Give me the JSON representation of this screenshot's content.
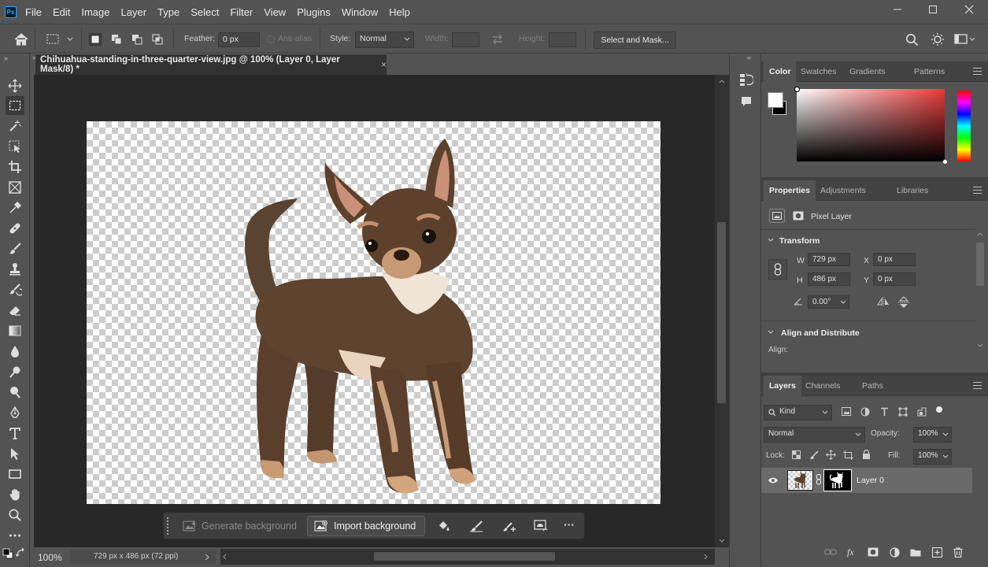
{
  "app": {
    "logo_text": "Ps",
    "menu": [
      "File",
      "Edit",
      "Image",
      "Layer",
      "Type",
      "Select",
      "Filter",
      "View",
      "Plugins",
      "Window",
      "Help"
    ]
  },
  "options_bar": {
    "feather_label": "Feather:",
    "feather_value": "0 px",
    "antialias_label": "Anti-alias",
    "style_label": "Style:",
    "style_value": "Normal",
    "width_label": "Width:",
    "height_label": "Height:",
    "select_and_mask": "Select and Mask..."
  },
  "document": {
    "tab_title": "Chihuahua-standing-in-three-quarter-view.jpg @ 100% (Layer 0, Layer Mask/8) *",
    "close_glyph": "×",
    "zoom": "100%",
    "doc_info": "729 px x 486 px (72 ppi)"
  },
  "contextual_bar": {
    "generate_background": "Generate background",
    "import_background": "Import background",
    "more": "···"
  },
  "color_panel": {
    "tabs": [
      "Color",
      "Swatches",
      "Gradients",
      "Patterns"
    ],
    "hue_color": "#e83a3a"
  },
  "properties_panel": {
    "tabs": [
      "Properties",
      "Adjustments",
      "Libraries"
    ],
    "layer_type": "Pixel Layer",
    "transform_title": "Transform",
    "w_label": "W",
    "w_value": "729 px",
    "h_label": "H",
    "h_value": "486 px",
    "x_label": "X",
    "x_value": "0 px",
    "y_label": "Y",
    "y_value": "0 px",
    "angle_value": "0.00°",
    "align_title": "Align and Distribute",
    "align_label": "Align:"
  },
  "layers_panel": {
    "tabs": [
      "Layers",
      "Channels",
      "Paths"
    ],
    "filter_kind": "Kind",
    "blend_mode": "Normal",
    "opacity_label": "Opacity:",
    "opacity_value": "100%",
    "lock_label": "Lock:",
    "fill_label": "Fill:",
    "fill_value": "100%",
    "layers": [
      {
        "name": "Layer 0",
        "visible": true,
        "has_mask": true
      }
    ],
    "fx_label": "fx"
  }
}
